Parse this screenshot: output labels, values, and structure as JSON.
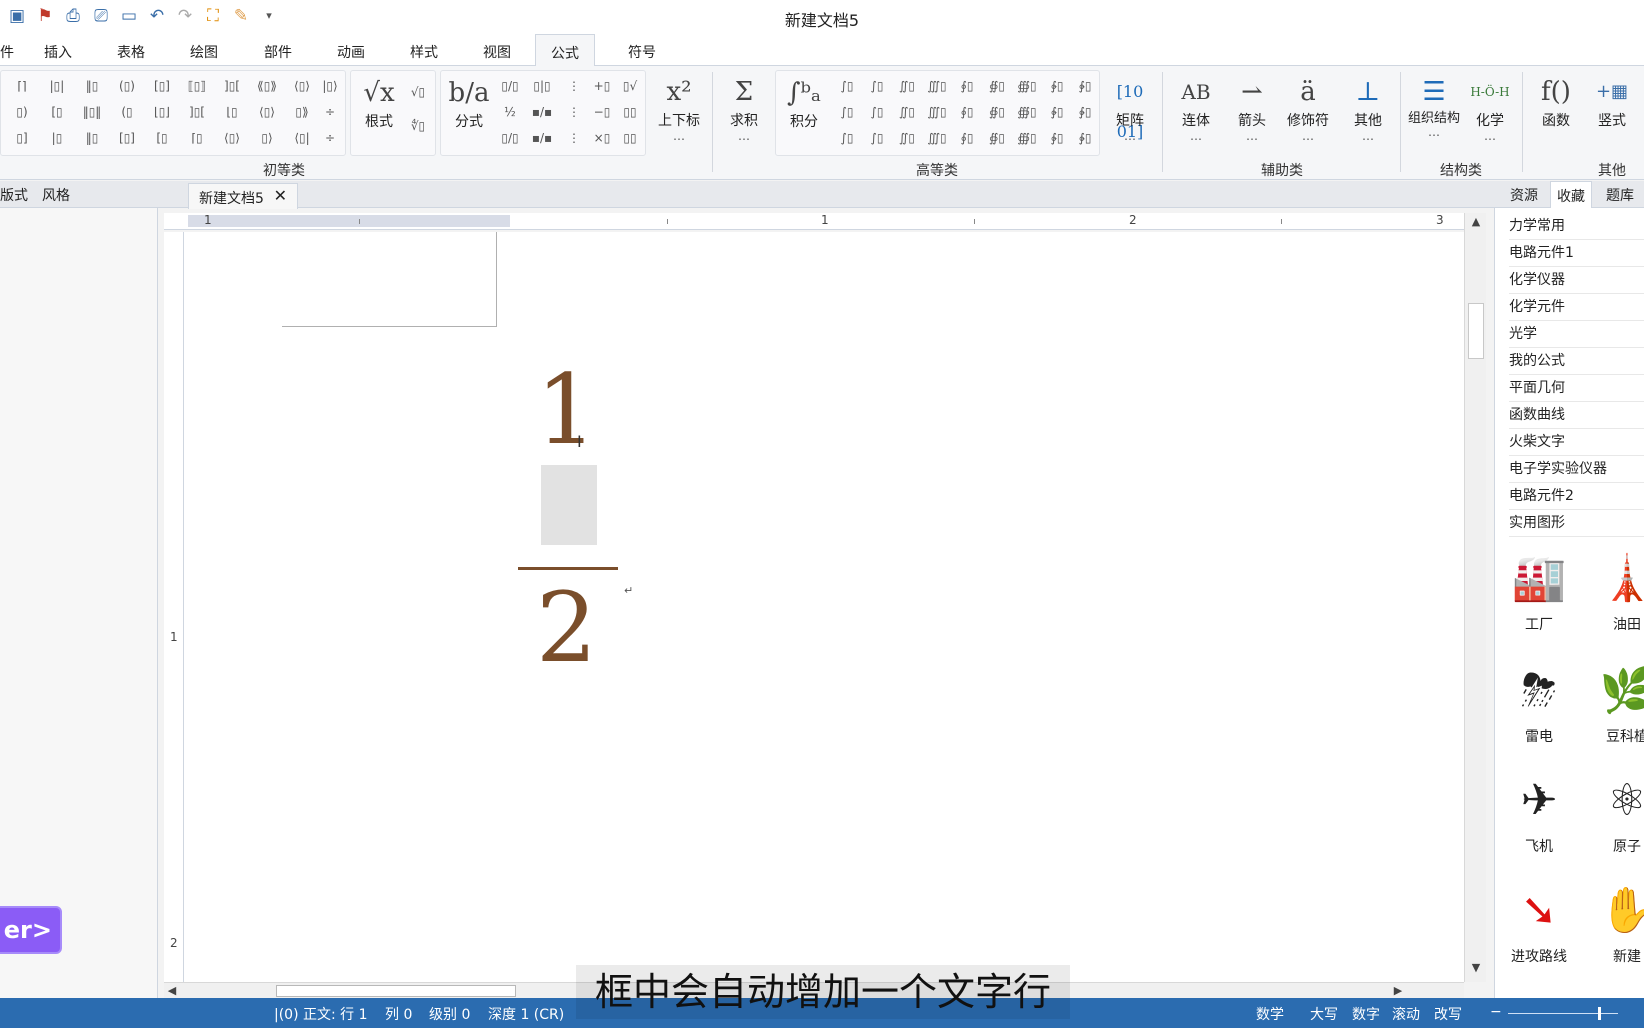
{
  "app": {
    "title": "新建文档5"
  },
  "qat_icons": [
    "save-icon",
    "pdf-icon",
    "print-preview-icon",
    "print-icon",
    "screen-icon",
    "undo-icon",
    "redo-icon",
    "fullscreen-icon",
    "brush-icon"
  ],
  "menus": [
    {
      "label": "件"
    },
    {
      "label": "插入"
    },
    {
      "label": "表格"
    },
    {
      "label": "绘图"
    },
    {
      "label": "部件"
    },
    {
      "label": "动画"
    },
    {
      "label": "样式"
    },
    {
      "label": "视图"
    },
    {
      "label": "公式",
      "active": true
    },
    {
      "label": "符号"
    }
  ],
  "ribbon": {
    "groups": {
      "elementary": "初等类",
      "advanced": "高等类",
      "auxiliary": "辅助类",
      "structure": "结构类",
      "other": "其他"
    },
    "buttons": {
      "radical": "根式",
      "fraction": "分式",
      "subsup": "上下标",
      "product": "求积",
      "integral": "积分",
      "matrix": "矩阵",
      "connector": "连体",
      "arrow": "箭头",
      "modifier": "修饰符",
      "others": "其他",
      "org": "组织结构",
      "chemistry": "化学",
      "function": "函数",
      "vertical": "竖式"
    },
    "more": "…"
  },
  "tabs": {
    "left": [
      "版式",
      "风格"
    ],
    "doc_tab": "新建文档5",
    "right": [
      "资源",
      "收藏",
      "题库"
    ]
  },
  "ruler": {
    "numbers": [
      "1",
      "1",
      "2",
      "3"
    ]
  },
  "vruler": {
    "numbers": [
      "1",
      "2"
    ]
  },
  "formula": {
    "numerator": "1",
    "denominator": "2"
  },
  "categories": [
    "力学常用",
    "电路元件1",
    "化学仪器",
    "化学元件",
    "光学",
    "我的公式",
    "平面几何",
    "函数曲线",
    "火柴文字",
    "电子学实验仪器",
    "电路元件2",
    "实用图形"
  ],
  "gallery": [
    {
      "caption": "工厂",
      "icon": "factory-icon"
    },
    {
      "caption": "油田",
      "icon": "oil-rig-icon"
    },
    {
      "caption": "雷电",
      "icon": "thunder-icon"
    },
    {
      "caption": "豆科植",
      "icon": "plant-icon"
    },
    {
      "caption": "飞机",
      "icon": "airplane-icon"
    },
    {
      "caption": "原子",
      "icon": "atom-icon"
    },
    {
      "caption": "进攻路线",
      "icon": "attack-arrow-icon"
    },
    {
      "caption": "新建",
      "icon": "hand-icon"
    }
  ],
  "status": {
    "position": "|(0) 正文: 行 1",
    "col": "列 0",
    "level": "级别 0",
    "depth": "深度 1 (CR)",
    "math": "数学",
    "caps": "大写",
    "num": "数字",
    "scroll": "滚动",
    "overwrite": "改写"
  },
  "subtitle": "框中会自动增加一个文字行",
  "overlay_badge": "er>"
}
